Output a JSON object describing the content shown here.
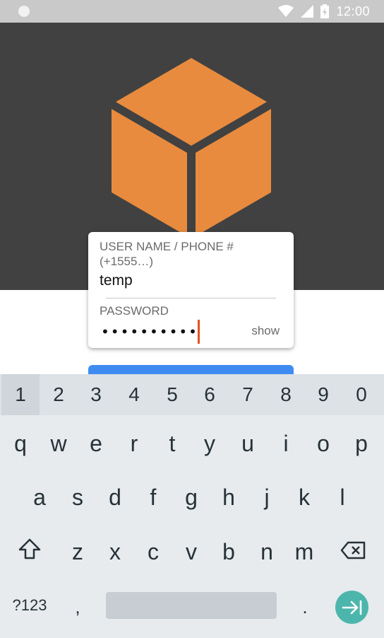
{
  "status_bar": {
    "time": "12:00"
  },
  "login": {
    "user_label": "USER NAME / PHONE # (+1555…)",
    "user_value": "temp",
    "password_label": "PASSWORD",
    "password_value": "••••••••••",
    "show_label": "show"
  },
  "keyboard": {
    "numbers": [
      "1",
      "2",
      "3",
      "4",
      "5",
      "6",
      "7",
      "8",
      "9",
      "0"
    ],
    "row1": [
      "q",
      "w",
      "e",
      "r",
      "t",
      "y",
      "u",
      "i",
      "o",
      "p"
    ],
    "row2": [
      "a",
      "s",
      "d",
      "f",
      "g",
      "h",
      "j",
      "k",
      "l"
    ],
    "row3": [
      "z",
      "x",
      "c",
      "v",
      "b",
      "n",
      "m"
    ],
    "symbols_label": "?123",
    "comma": ",",
    "period": "."
  },
  "colors": {
    "hero_bg": "#414141",
    "logo": "#e88b3e",
    "accent_blue": "#3f8cf1",
    "enter_teal": "#4db6ac",
    "caret": "#e1531f"
  }
}
